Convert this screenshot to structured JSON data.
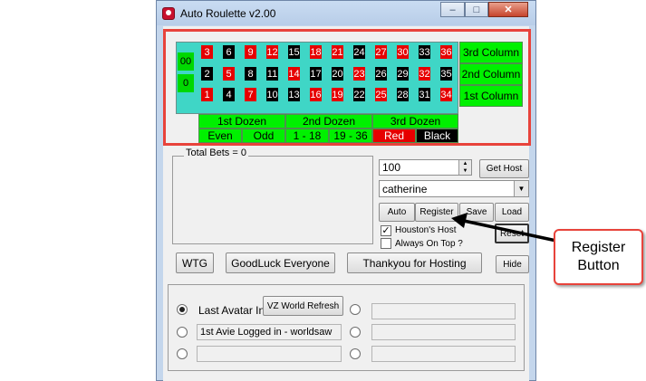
{
  "window": {
    "title": "Auto Roulette v2.00",
    "minimize_glyph": "–",
    "maximize_glyph": "□",
    "close_glyph": "✕"
  },
  "roulette": {
    "zero": "0",
    "double_zero": "00",
    "rows": [
      [
        {
          "n": "3",
          "c": "red"
        },
        {
          "n": "6",
          "c": "black"
        },
        {
          "n": "9",
          "c": "red"
        },
        {
          "n": "12",
          "c": "red"
        },
        {
          "n": "15",
          "c": "black"
        },
        {
          "n": "18",
          "c": "red"
        },
        {
          "n": "21",
          "c": "red"
        },
        {
          "n": "24",
          "c": "black"
        },
        {
          "n": "27",
          "c": "red"
        },
        {
          "n": "30",
          "c": "red"
        },
        {
          "n": "33",
          "c": "black"
        },
        {
          "n": "36",
          "c": "red"
        }
      ],
      [
        {
          "n": "2",
          "c": "black"
        },
        {
          "n": "5",
          "c": "red"
        },
        {
          "n": "8",
          "c": "black"
        },
        {
          "n": "11",
          "c": "black"
        },
        {
          "n": "14",
          "c": "red"
        },
        {
          "n": "17",
          "c": "black"
        },
        {
          "n": "20",
          "c": "black"
        },
        {
          "n": "23",
          "c": "red"
        },
        {
          "n": "26",
          "c": "black"
        },
        {
          "n": "29",
          "c": "black"
        },
        {
          "n": "32",
          "c": "red"
        },
        {
          "n": "35",
          "c": "black"
        }
      ],
      [
        {
          "n": "1",
          "c": "red"
        },
        {
          "n": "4",
          "c": "black"
        },
        {
          "n": "7",
          "c": "red"
        },
        {
          "n": "10",
          "c": "black"
        },
        {
          "n": "13",
          "c": "black"
        },
        {
          "n": "16",
          "c": "red"
        },
        {
          "n": "19",
          "c": "red"
        },
        {
          "n": "22",
          "c": "black"
        },
        {
          "n": "25",
          "c": "red"
        },
        {
          "n": "28",
          "c": "black"
        },
        {
          "n": "31",
          "c": "black"
        },
        {
          "n": "34",
          "c": "red"
        }
      ]
    ],
    "columns": [
      "3rd Column",
      "2nd Column",
      "1st Column"
    ],
    "dozens": [
      "1st Dozen",
      "2nd  Dozen",
      "3rd Dozen"
    ],
    "outside": {
      "even": "Even",
      "odd": "Odd",
      "low": "1 - 18",
      "high": "19 - 36",
      "red": "Red",
      "black": "Black"
    }
  },
  "bets": {
    "label": "Total Bets = 0"
  },
  "controls": {
    "amount_value": "100",
    "host_value": "catherine",
    "get_host": "Get Host",
    "auto": "Auto",
    "register": "Register",
    "save": "Save",
    "load": "Load",
    "reset": "Reset",
    "houstons_host_label": "Houston's Host",
    "houstons_host_checked": true,
    "always_on_top_label": "Always On Top ?",
    "always_on_top_checked": false,
    "spinner_up": "▲",
    "spinner_down": "▼",
    "dropdown_arrow": "▼"
  },
  "actions": {
    "wtg": "WTG",
    "goodluck": "GoodLuck Everyone",
    "thankyou": "Thankyou for Hosting",
    "hide": "Hide"
  },
  "avatars": {
    "last_avatar_label": "Last Avatar In",
    "vz_refresh": "VZ World Refresh",
    "first_avie": "1st Avie Logged in - worldsaw"
  },
  "callout": {
    "line1": "Register",
    "line2": "Button"
  },
  "colors": {
    "red": "#e60000",
    "black": "#000000",
    "felt": "#3fd6c6",
    "bet_green": "#00f000",
    "highlight": "#e8433b"
  }
}
